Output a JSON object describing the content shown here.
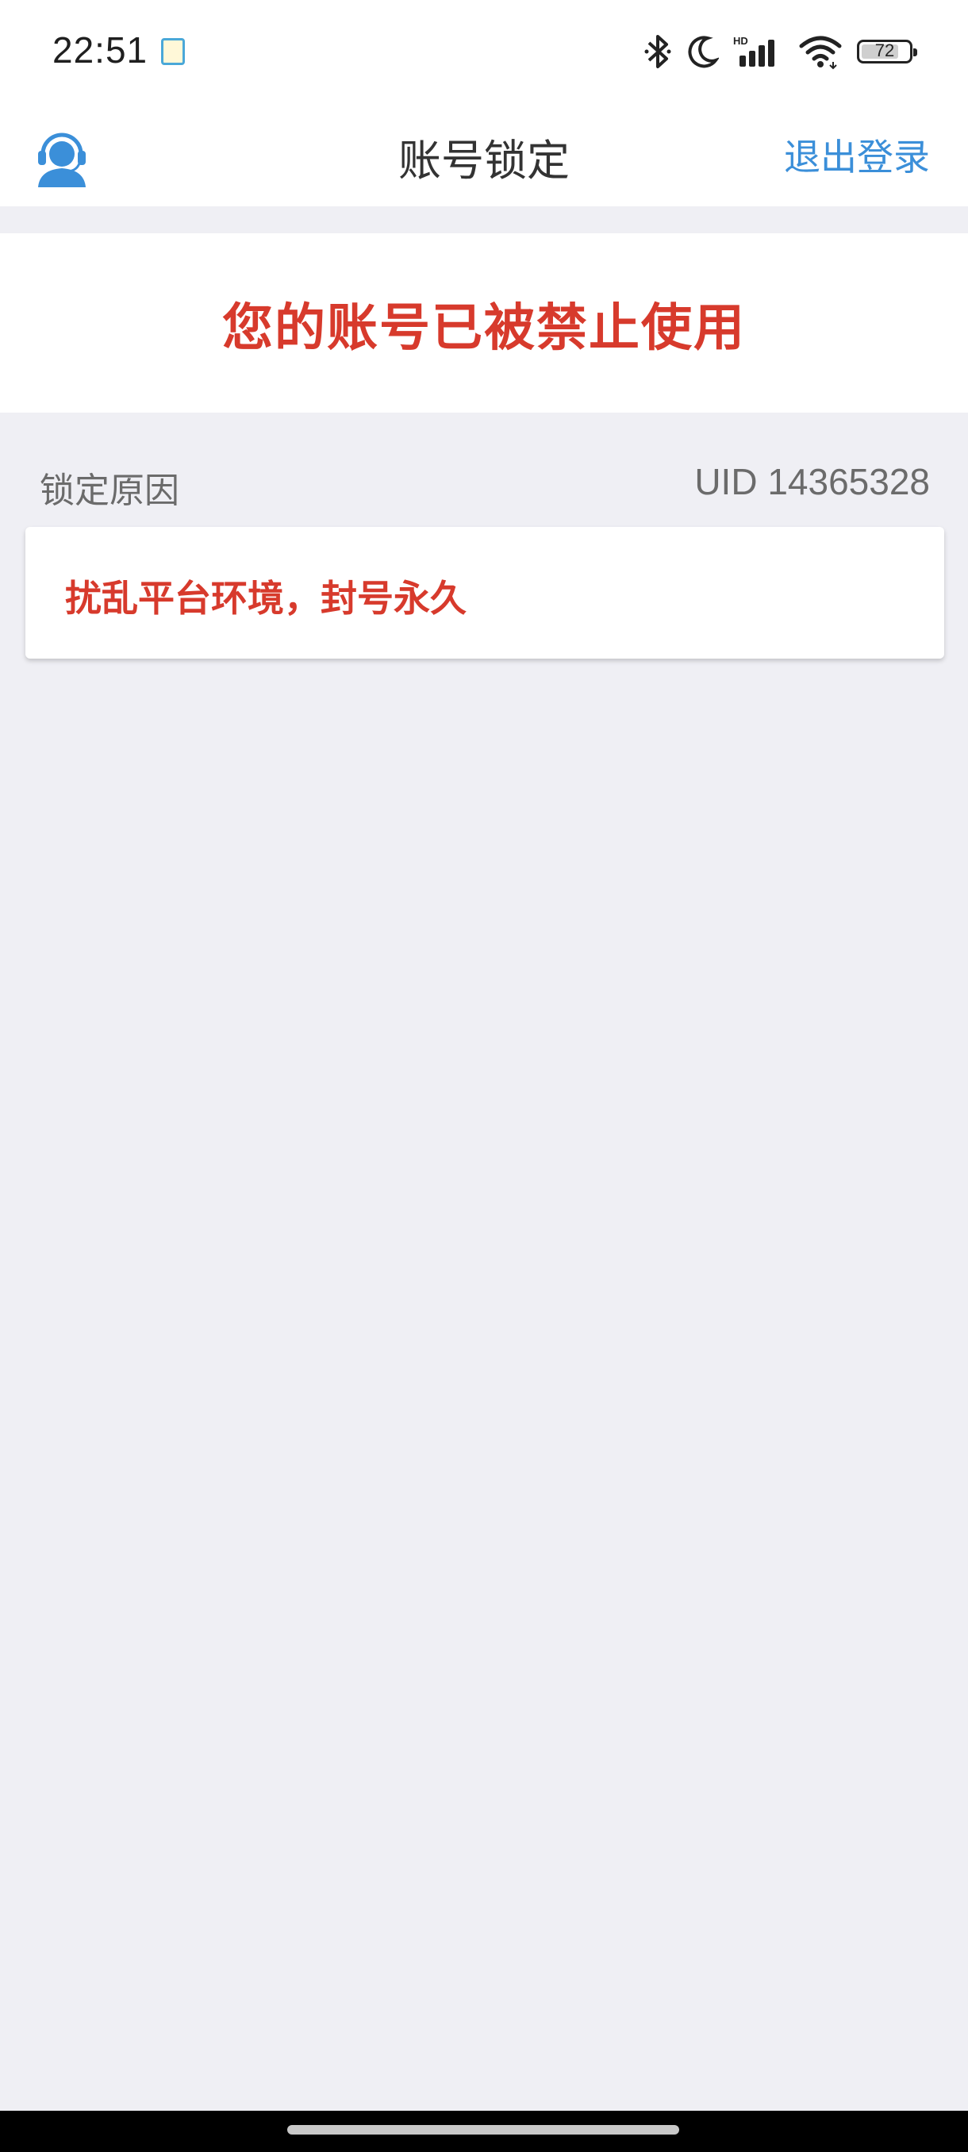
{
  "status_bar": {
    "time": "22:51",
    "battery_level": "72",
    "icons": [
      "app-notification-icon",
      "bluetooth-icon",
      "moon-icon",
      "hd-signal-icon",
      "wifi-icon",
      "battery-icon"
    ]
  },
  "navbar": {
    "title": "账号锁定",
    "logout_label": "退出登录",
    "avatar_icon": "customer-service-icon"
  },
  "banner": {
    "message": "您的账号已被禁止使用"
  },
  "reason_section": {
    "label": "锁定原因",
    "uid": "UID 14365328",
    "reason": "扰乱平台环境，封号永久"
  },
  "colors": {
    "accent": "#3b8fd9",
    "warning": "#d73a2c",
    "background": "#efeff4"
  }
}
